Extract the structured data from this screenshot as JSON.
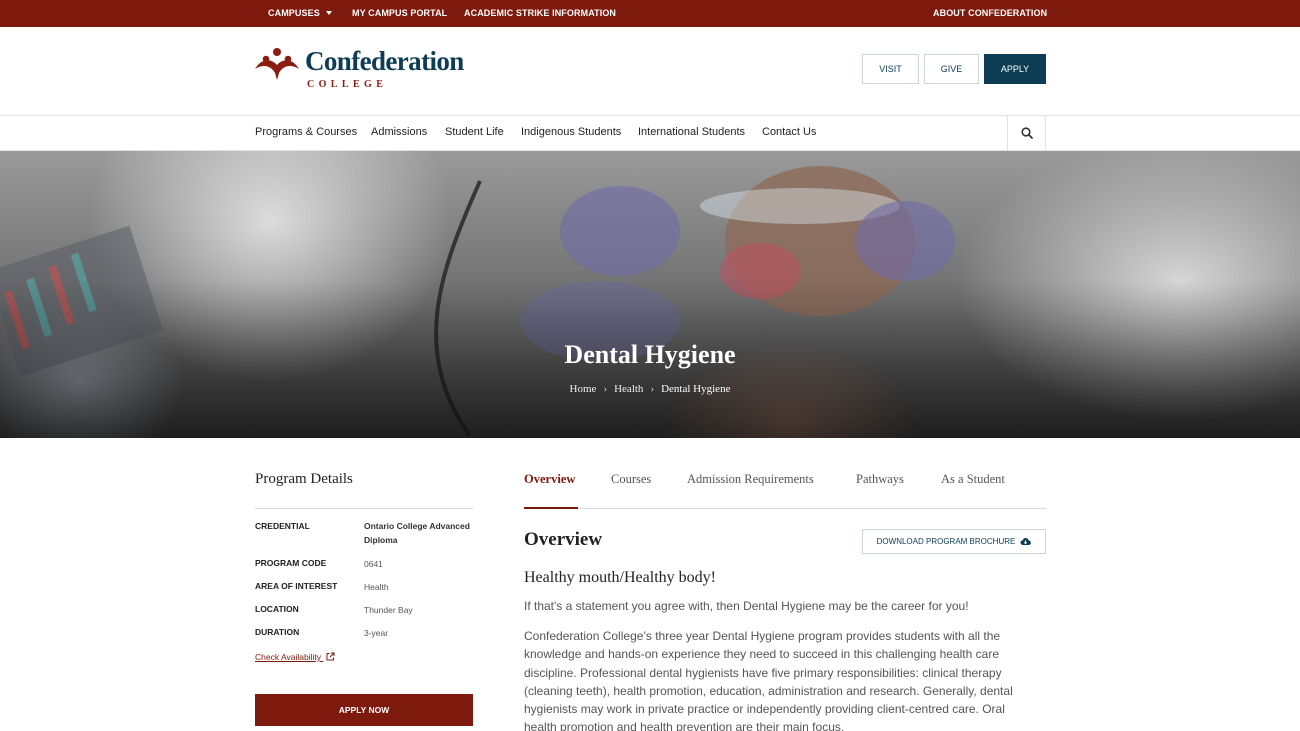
{
  "topbar": {
    "campuses": "CAMPUSES",
    "portal": "MY CAMPUS PORTAL",
    "strike": "ACADEMIC STRIKE INFORMATION",
    "about": "ABOUT CONFEDERATION"
  },
  "logo": {
    "name": "Confederation",
    "sub": "COLLEGE"
  },
  "header_buttons": {
    "visit": "VISIT",
    "give": "GIVE",
    "apply": "APPLY"
  },
  "nav": [
    "Programs & Courses",
    "Admissions",
    "Student Life",
    "Indigenous Students",
    "International Students",
    "Contact Us"
  ],
  "hero": {
    "title": "Dental Hygiene",
    "breadcrumb": [
      "Home",
      "Health",
      "Dental Hygiene"
    ]
  },
  "program_details": {
    "title": "Program Details",
    "rows": [
      {
        "label": "CREDENTIAL",
        "value": "Ontario College Advanced Diploma"
      },
      {
        "label": "PROGRAM CODE",
        "value": "0641"
      },
      {
        "label": "AREA OF INTEREST",
        "value": "Health"
      },
      {
        "label": "LOCATION",
        "value": "Thunder Bay"
      },
      {
        "label": "DURATION",
        "value": "3-year"
      }
    ],
    "check_availability": "Check Availability",
    "apply_now": "APPLY NOW"
  },
  "tabs": [
    "Overview",
    "Courses",
    "Admission Requirements",
    "Pathways",
    "As a Student"
  ],
  "active_tab": "Overview",
  "content": {
    "heading": "Overview",
    "download": "DOWNLOAD PROGRAM BROCHURE",
    "subheading": "Healthy mouth/Healthy body!",
    "intro": "If that's a statement you agree with, then Dental Hygiene may be the career for you!",
    "body": "Confederation College’s three year Dental Hygiene program provides students with all the knowledge and hands-on experience they need to succeed in this challenging health care discipline. Professional dental hygienists have five primary responsibilities: clinical therapy (cleaning teeth), health promotion, education, administration and research. Generally, dental hygienists may work in private practice or independently providing client-centred care. Oral health promotion and health prevention are their main focus."
  },
  "colors": {
    "maroon": "#7d1a0d",
    "navy": "#0d3c55"
  }
}
